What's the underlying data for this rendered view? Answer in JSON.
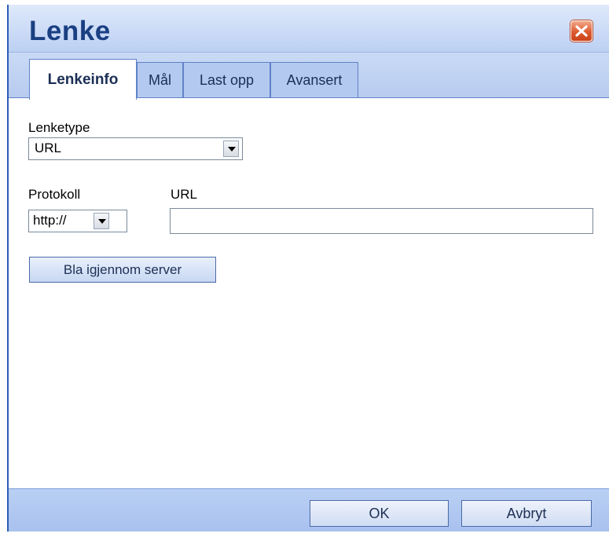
{
  "dialog": {
    "title": "Lenke",
    "close_icon": "close-icon"
  },
  "tabs": [
    {
      "label": "Lenkeinfo",
      "active": true
    },
    {
      "label": "Mål",
      "active": false
    },
    {
      "label": "Last opp",
      "active": false
    },
    {
      "label": "Avansert",
      "active": false
    }
  ],
  "form": {
    "link_type": {
      "label": "Lenketype",
      "value": "URL"
    },
    "protocol": {
      "label": "Protokoll",
      "value": "http://"
    },
    "url": {
      "label": "URL",
      "value": ""
    },
    "browse_label": "Bla igjennom server"
  },
  "footer": {
    "ok_label": "OK",
    "cancel_label": "Avbryt"
  },
  "colors": {
    "frame": "#3f69c2",
    "title_text": "#1a3f82",
    "close_button": "#dd5a2f"
  }
}
